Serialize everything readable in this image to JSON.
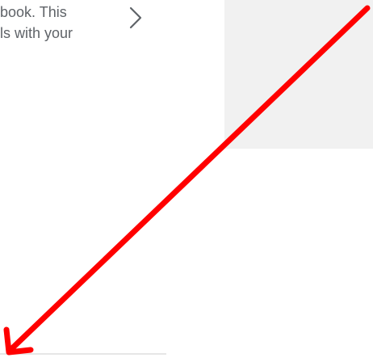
{
  "description": {
    "line1": "book. This",
    "line2": "ls with your"
  },
  "icons": {
    "chevron": "chevron-right-icon",
    "annotation": "arrow-annotation-icon"
  },
  "colors": {
    "text": "#5f6368",
    "annotation": "#ff0000",
    "thumbnail_placeholder": "#f1f1f1"
  }
}
